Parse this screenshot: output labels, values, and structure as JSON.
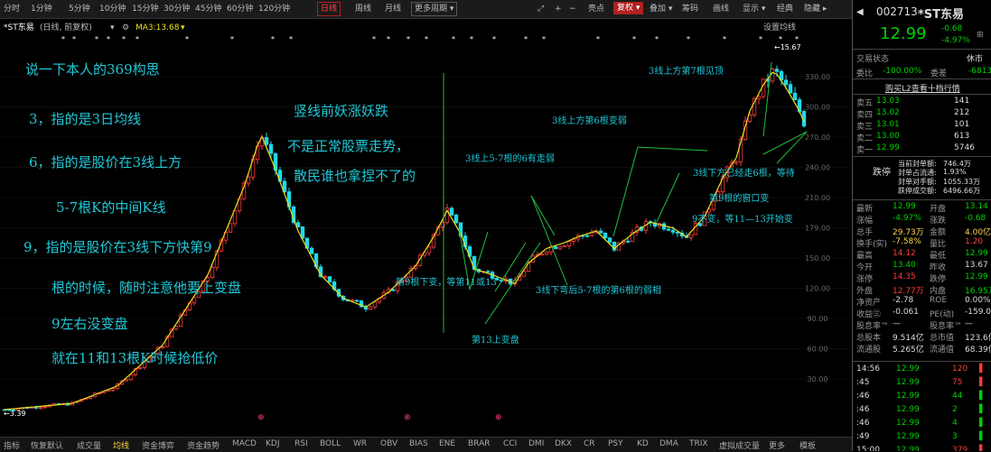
{
  "toolbar": {
    "periods": [
      "分时",
      "1分钟",
      "5分钟",
      "10分钟",
      "15分钟",
      "30分钟",
      "45分钟",
      "60分钟",
      "120分钟",
      "日线",
      "周线",
      "月线",
      "更多周期"
    ],
    "active_period": "日线",
    "right_items": [
      "亮点",
      "复权",
      "叠加",
      "筹码",
      "画线",
      "显示",
      "经典",
      "隐藏"
    ],
    "restore_label": "复权"
  },
  "chart_header": {
    "stock": "*ST东易",
    "mode": "(日线, 前复权)",
    "ma_label": "MA3:13.68",
    "settings": "设置均线"
  },
  "y_axis": [
    "330.00",
    "300.00",
    "270.00",
    "240.00",
    "210.00",
    "179.00",
    "150.00",
    "120.00",
    "90.00",
    "60.00",
    "30.00"
  ],
  "chart_labels": {
    "high": "←15.67",
    "low": "←3.39",
    "marker": "⊕"
  },
  "chart_data": {
    "type": "candlestick",
    "series": [
      {
        "name": "MA3",
        "type": "line",
        "color": "#e8e020"
      }
    ],
    "high": 15.67,
    "low": 3.39
  },
  "annotations": [
    "说一下本人的369构思",
    "3，指的是3日均线",
    "6，指的是股价在3线上方",
    "5-7根K的中间K线",
    "9，指的是股价在3线下方快第9",
    "根的时候，随时注意他要上变盘",
    "9左右没变盘",
    "就在11和13根K时候抢低价",
    "竖线前妖涨妖跌",
    "不是正常股票走势，",
    "散民谁也拿捏不了的",
    "3线上5-7根的6有走弱",
    "第9根下变，等第11或13",
    "第13上变盘",
    "3线下弯后5-7根的第6根的弱相",
    "3线上方第6根变弱",
    "3线上方第7根见顶",
    "3线下方已经走6根，等待",
    "第9根的窗口变",
    "9不变，等11—13开始变"
  ],
  "bottom_tabs": [
    "指标",
    "恢复默认",
    "成交量",
    "均线",
    "资金博弈",
    "资金趋势",
    "MACD",
    "KDJ",
    "RSI",
    "BOLL",
    "WR",
    "OBV",
    "BIAS",
    "ENE",
    "BRAR",
    "CCI",
    "DMI",
    "DKX",
    "CR",
    "PSY",
    "KD",
    "DMA",
    "TRIX",
    "虚拟成交量",
    "更多",
    "模板"
  ],
  "active_tab": "均线",
  "quote": {
    "code": "002713",
    "name": "*ST东易",
    "price": "12.99",
    "change": "-0.68",
    "change_pct": "-4.97%",
    "trade_status_label": "交易状态",
    "trade_status": "休市",
    "weibi_label": "委比",
    "weibi": "-100.00%",
    "weicha_label": "委差",
    "weicha": "-6813",
    "l2_link": "购买L2查看十档行情",
    "asks": [
      {
        "label": "卖五",
        "price": "13.03",
        "vol": "141"
      },
      {
        "label": "卖四",
        "price": "13.02",
        "vol": "212"
      },
      {
        "label": "卖三",
        "price": "13.01",
        "vol": "101"
      },
      {
        "label": "卖二",
        "price": "13.00",
        "vol": "613"
      },
      {
        "label": "卖一",
        "price": "12.99",
        "vol": "5746"
      }
    ],
    "limit_down": "跌停",
    "limit_info": [
      {
        "k": "当前封单额:",
        "v": "746.4万"
      },
      {
        "k": "封单占流通:",
        "v": "1.93%"
      },
      {
        "k": "封单对手额:",
        "v": "1055.33万"
      },
      {
        "k": "跌停成交额:",
        "v": "6496.66万"
      }
    ],
    "stats": [
      {
        "l": "最新",
        "lv": "12.99",
        "lc": "g",
        "r": "开盘",
        "rv": "13.14",
        "rc": "g"
      },
      {
        "l": "涨幅",
        "lv": "-4.97%",
        "lc": "g",
        "r": "涨跌",
        "rv": "-0.68",
        "rc": "g"
      },
      {
        "l": "总手",
        "lv": "29.73万",
        "lc": "y",
        "r": "金额",
        "rv": "4.00亿",
        "rc": "y"
      },
      {
        "l": "换手(实)",
        "lv": "-7.58%",
        "lc": "y",
        "r": "量比",
        "rv": "1.20",
        "rc": "r"
      },
      {
        "l": "最高",
        "lv": "14.12",
        "lc": "r",
        "r": "最低",
        "rv": "12.99",
        "rc": "g"
      },
      {
        "l": "今开",
        "lv": "13.40",
        "lc": "g",
        "r": "昨收",
        "rv": "13.67",
        "rc": "w"
      },
      {
        "l": "涨停",
        "lv": "14.35",
        "lc": "r",
        "r": "跌停",
        "rv": "12.99",
        "rc": "g"
      },
      {
        "l": "外盘",
        "lv": "12.77万",
        "lc": "r",
        "r": "内盘",
        "rv": "16.95万",
        "rc": "g"
      },
      {
        "l": "净资产",
        "lv": "-2.78",
        "lc": "w",
        "r": "ROE",
        "rv": "0.00%",
        "rc": "w"
      },
      {
        "l": "收益㊂",
        "lv": "-0.061",
        "lc": "w",
        "r": "PE(动)",
        "rv": "-159.09",
        "rc": "w"
      },
      {
        "l": "股息率™",
        "lv": "—",
        "lc": "w",
        "r": "股息率™",
        "rv": "—",
        "rc": "w"
      },
      {
        "l": "总股本",
        "lv": "9.514亿",
        "lc": "w",
        "r": "总市值",
        "rv": "123.6亿",
        "rc": "w"
      },
      {
        "l": "流通股",
        "lv": "5.265亿",
        "lc": "w",
        "r": "流通值",
        "rv": "68.39亿",
        "rc": "w"
      }
    ],
    "ticks": [
      {
        "t": "14:56",
        "p": "12.99",
        "v": "120"
      },
      {
        "t": ":45",
        "p": "12.99",
        "v": "75"
      },
      {
        "t": ":46",
        "p": "12.99",
        "v": "44"
      },
      {
        "t": ":46",
        "p": "12.99",
        "v": "2"
      },
      {
        "t": ":46",
        "p": "12.99",
        "v": "4"
      },
      {
        "t": ":49",
        "p": "12.99",
        "v": "3"
      },
      {
        "t": "15:00",
        "p": "12.99",
        "v": "379"
      }
    ]
  }
}
